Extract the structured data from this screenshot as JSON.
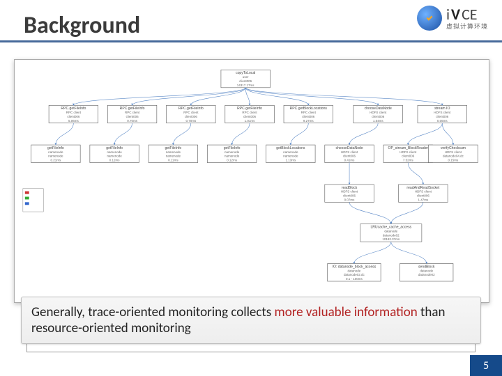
{
  "title": "Background",
  "logo": {
    "bold": "V",
    "mid": "CE",
    "prefix": "i",
    "sub": "虚拟计算环境"
  },
  "page_number": "5",
  "callout": {
    "pre": "Generally, trace-oriented monitoring collects ",
    "hl1": "more valuable information",
    "mid": " than resource-oriented monitoring",
    "post": ""
  },
  "diagram": {
    "legend": [
      "",
      "",
      ""
    ],
    "root": {
      "l1": "copyToLocal",
      "l2": "user",
      "l3": "client006",
      "l4": "14317.17ms"
    },
    "row1": [
      {
        "l1": "RPC.getFileInfo",
        "l2": "RPC client",
        "l3": "client006",
        "l4": "5.06ms"
      },
      {
        "l1": "RPC.getFileInfo",
        "l2": "RPC client",
        "l3": "client006",
        "l4": "0.70ms"
      },
      {
        "l1": "RPC.getFileInfo",
        "l2": "RPC client",
        "l3": "client006",
        "l4": "0.70ms"
      },
      {
        "l1": "RPC.getFileInfo",
        "l2": "RPC client",
        "l3": "client006",
        "l4": "1.01ms"
      },
      {
        "l1": "RPC.getBlockLocations",
        "l2": "RPC client",
        "l3": "client006",
        "l4": "9.27ms"
      },
      {
        "l1": "chooseDataNode",
        "l2": "HDFS client",
        "l3": "client006",
        "l4": "1.54ms"
      },
      {
        "l1": "stream IO",
        "l2": "HDFS client",
        "l3": "client006",
        "l4": "0.05ms"
      }
    ],
    "row2": [
      {
        "l1": "getFileInfo",
        "l2": "namenode",
        "l3": "namenode",
        "l4": "0.21ms"
      },
      {
        "l1": "getFileInfo",
        "l2": "namenode",
        "l3": "namenode",
        "l4": "0.12ms"
      },
      {
        "l1": "getFileInfo",
        "l2": "namenode",
        "l3": "namenode",
        "l4": "0.11ms"
      },
      {
        "l1": "getFileInfo",
        "l2": "namenode",
        "l3": "namenode",
        "l4": "0.12ms"
      },
      {
        "l1": "getBlockLocations",
        "l2": "namenode",
        "l3": "namenode",
        "l4": "1.13ms"
      },
      {
        "l1": "chooseDataNode",
        "l2": "HDFS client",
        "l3": "client006",
        "l4": "0.41ms"
      },
      {
        "l1": "OP_stream_BlockReader",
        "l2": "HDFS client",
        "l3": "client006",
        "l4": "7.52ms"
      },
      {
        "l1": "verifyChecksum",
        "l2": "HDFS client",
        "l3": "datanode04.dc",
        "l4": "0.15ms"
      }
    ],
    "row3": [
      {
        "l1": "readBlock",
        "l2": "HDFS client",
        "l3": "client006",
        "l4": "0.07ms"
      },
      {
        "l1": "readAndReadSocket",
        "l2": "HDFS client",
        "l3": "client006",
        "l4": "1.47ms"
      }
    ],
    "row4": [
      {
        "l1": "LRUcache_cache_access",
        "l2": "datanode",
        "l3": "datanode02",
        "l4": "10182.37ms"
      }
    ],
    "row5": [
      {
        "l1": "IO: datanode_block_access",
        "l2": "datanode",
        "l3": "datanode02.dc",
        "l4": "0.1 - 100ms"
      },
      {
        "l1": "sendBlock",
        "l2": "datanode",
        "l3": "datanode02",
        "l4": ""
      }
    ]
  }
}
